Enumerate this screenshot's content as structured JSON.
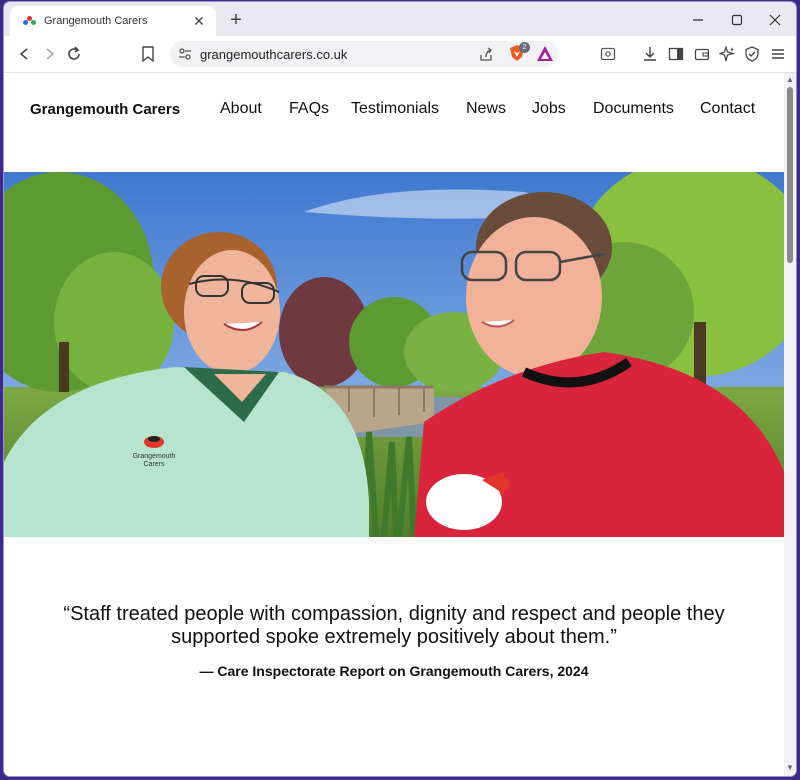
{
  "browser": {
    "tab_title": "Grangemouth Carers",
    "url": "grangemouthcarers.co.uk",
    "shield_badge_count": "2"
  },
  "site": {
    "brand": "Grangemouth Carers",
    "nav": [
      "About",
      "FAQs",
      "Testimonials",
      "News",
      "Jobs",
      "Documents",
      "Contact"
    ]
  },
  "hero": {
    "uniform_logo_text_line1": "Grangemouth",
    "uniform_logo_text_line2": "Carers"
  },
  "testimonial": {
    "quote_line1": "“Staff treated people with compassion, dignity and respect and people they",
    "quote_line2": "supported spoke extremely positively about them.”",
    "attribution": "— Care Inspectorate Report on Grangemouth Carers, 2024"
  },
  "colors": {
    "accent": "#e0362c",
    "sky": "#5b8fd9",
    "red_top": "#d9253c",
    "tunic": "#b6e4cf"
  }
}
